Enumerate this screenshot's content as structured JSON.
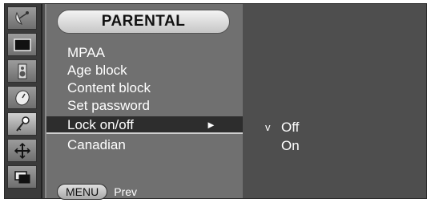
{
  "sidebar": {
    "icons": [
      {
        "name": "satellite-dish-icon",
        "selected": false
      },
      {
        "name": "picture-icon",
        "selected": false
      },
      {
        "name": "audio-speaker-icon",
        "selected": false
      },
      {
        "name": "clock-icon",
        "selected": false
      },
      {
        "name": "key-icon",
        "selected": true
      },
      {
        "name": "setup-icon",
        "selected": false
      },
      {
        "name": "input-source-icon",
        "selected": false
      }
    ]
  },
  "menu": {
    "title": "PARENTAL",
    "items": [
      {
        "label": "MPAA"
      },
      {
        "label": "Age block"
      },
      {
        "label": "Content block"
      },
      {
        "label": "Set password"
      },
      {
        "label": "Lock on/off",
        "selected": true,
        "arrow": "►"
      },
      {
        "label": "Canadian"
      }
    ],
    "footer": {
      "button": "MENU",
      "label": "Prev"
    }
  },
  "submenu": {
    "check_mark": "v",
    "options": [
      {
        "label": "Off",
        "checked": true
      },
      {
        "label": "On",
        "checked": false
      }
    ]
  }
}
